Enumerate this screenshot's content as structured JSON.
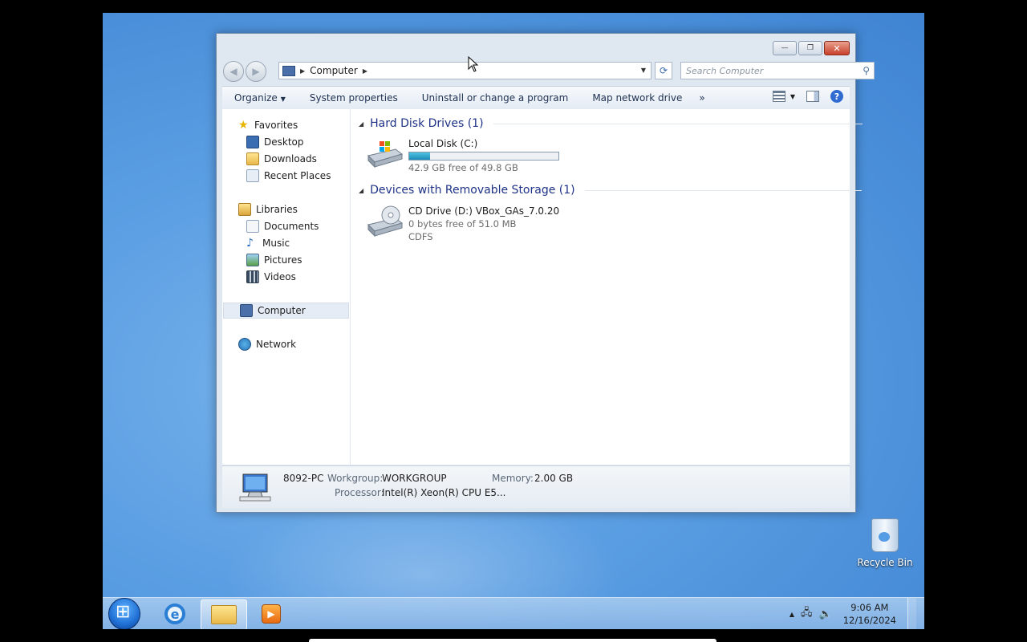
{
  "window": {
    "minimize_symbol": "—",
    "maximize_symbol": "❐",
    "close_symbol": "✕"
  },
  "address": {
    "crumb": "Computer",
    "search_placeholder": "Search Computer"
  },
  "toolbar": {
    "organize": "Organize",
    "system_properties": "System properties",
    "uninstall": "Uninstall or change a program",
    "map_drive": "Map network drive",
    "overflow": "»"
  },
  "navpane": {
    "favorites": "Favorites",
    "desktop": "Desktop",
    "downloads": "Downloads",
    "recent_places": "Recent Places",
    "libraries": "Libraries",
    "documents": "Documents",
    "music": "Music",
    "pictures": "Pictures",
    "videos": "Videos",
    "computer": "Computer",
    "network": "Network"
  },
  "content": {
    "hard_disk_group": "Hard Disk Drives (1)",
    "removable_group": "Devices with Removable Storage (1)",
    "local_disk": {
      "name": "Local Disk (C:)",
      "free": "42.9 GB free of 49.8 GB",
      "used_fraction": 0.14
    },
    "cd_drive": {
      "name": "CD Drive (D:) VBox_GAs_7.0.20",
      "free": "0 bytes free of 51.0 MB",
      "fs": "CDFS"
    }
  },
  "details": {
    "pc_name": "8092-PC",
    "workgroup_label": "Workgroup:",
    "workgroup_value": "WORKGROUP",
    "memory_label": "Memory:",
    "memory_value": "2.00 GB",
    "processor_label": "Processor:",
    "processor_value": "Intel(R) Xeon(R) CPU E5..."
  },
  "desktop": {
    "recycle_bin": "Recycle Bin"
  },
  "taskbar": {
    "time": "9:06 AM",
    "date": "12/16/2024"
  },
  "icons": {
    "favorites": "star-icon",
    "desktop": "desktop-icon",
    "downloads": "downloads-icon",
    "recent": "recent-places-icon",
    "libraries": "libraries-icon",
    "documents": "documents-icon",
    "music": "music-icon",
    "pictures": "pictures-icon",
    "videos": "videos-icon",
    "computer": "computer-icon",
    "network": "network-icon"
  },
  "colors": {
    "accent": "#1e3287",
    "drive_bar": "#1c8cb8",
    "desktop_bg": "#4a8fd9"
  }
}
